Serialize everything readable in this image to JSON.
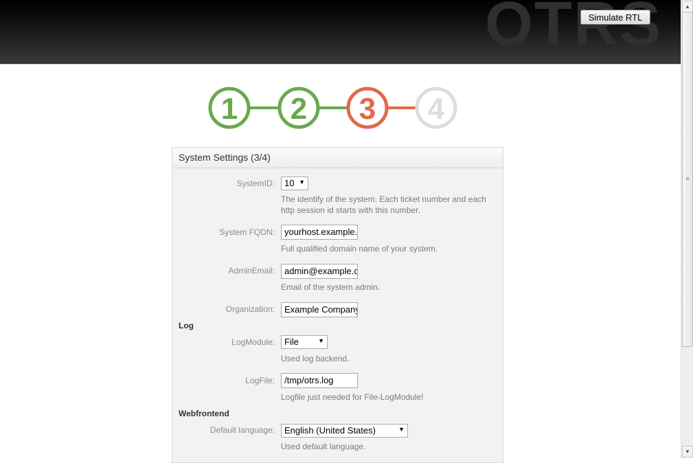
{
  "header": {
    "logo_text": "OTRS",
    "simulate_rtl_label": "Simulate RTL"
  },
  "steps": {
    "items": [
      "1",
      "2",
      "3",
      "4"
    ],
    "current": 3,
    "colors": {
      "done": "#6aa84f",
      "current": "#e06a4a",
      "todo": "#dddddd"
    }
  },
  "panel": {
    "title": "System Settings (3/4)",
    "fields": {
      "system_id": {
        "label": "SystemID:",
        "value": "10",
        "help": "The identify of the system. Each ticket number and each http session id starts with this number."
      },
      "fqdn": {
        "label": "System FQDN:",
        "value": "yourhost.example.com",
        "help": "Full qualified domain name of your system."
      },
      "admin_email": {
        "label": "AdminEmail:",
        "value": "admin@example.com",
        "help": "Email of the system admin."
      },
      "organization": {
        "label": "Organization:",
        "value": "Example Company"
      }
    },
    "log_section": "Log",
    "log": {
      "module": {
        "label": "LogModule:",
        "value": "File",
        "help": "Used log backend."
      },
      "file": {
        "label": "LogFile:",
        "value": "/tmp/otrs.log",
        "help": "Logfile just needed for File-LogModule!"
      }
    },
    "web_section": "Webfrontend",
    "web": {
      "language": {
        "label": "Default language:",
        "value": "English (United States)",
        "help": "Used default language."
      }
    }
  }
}
